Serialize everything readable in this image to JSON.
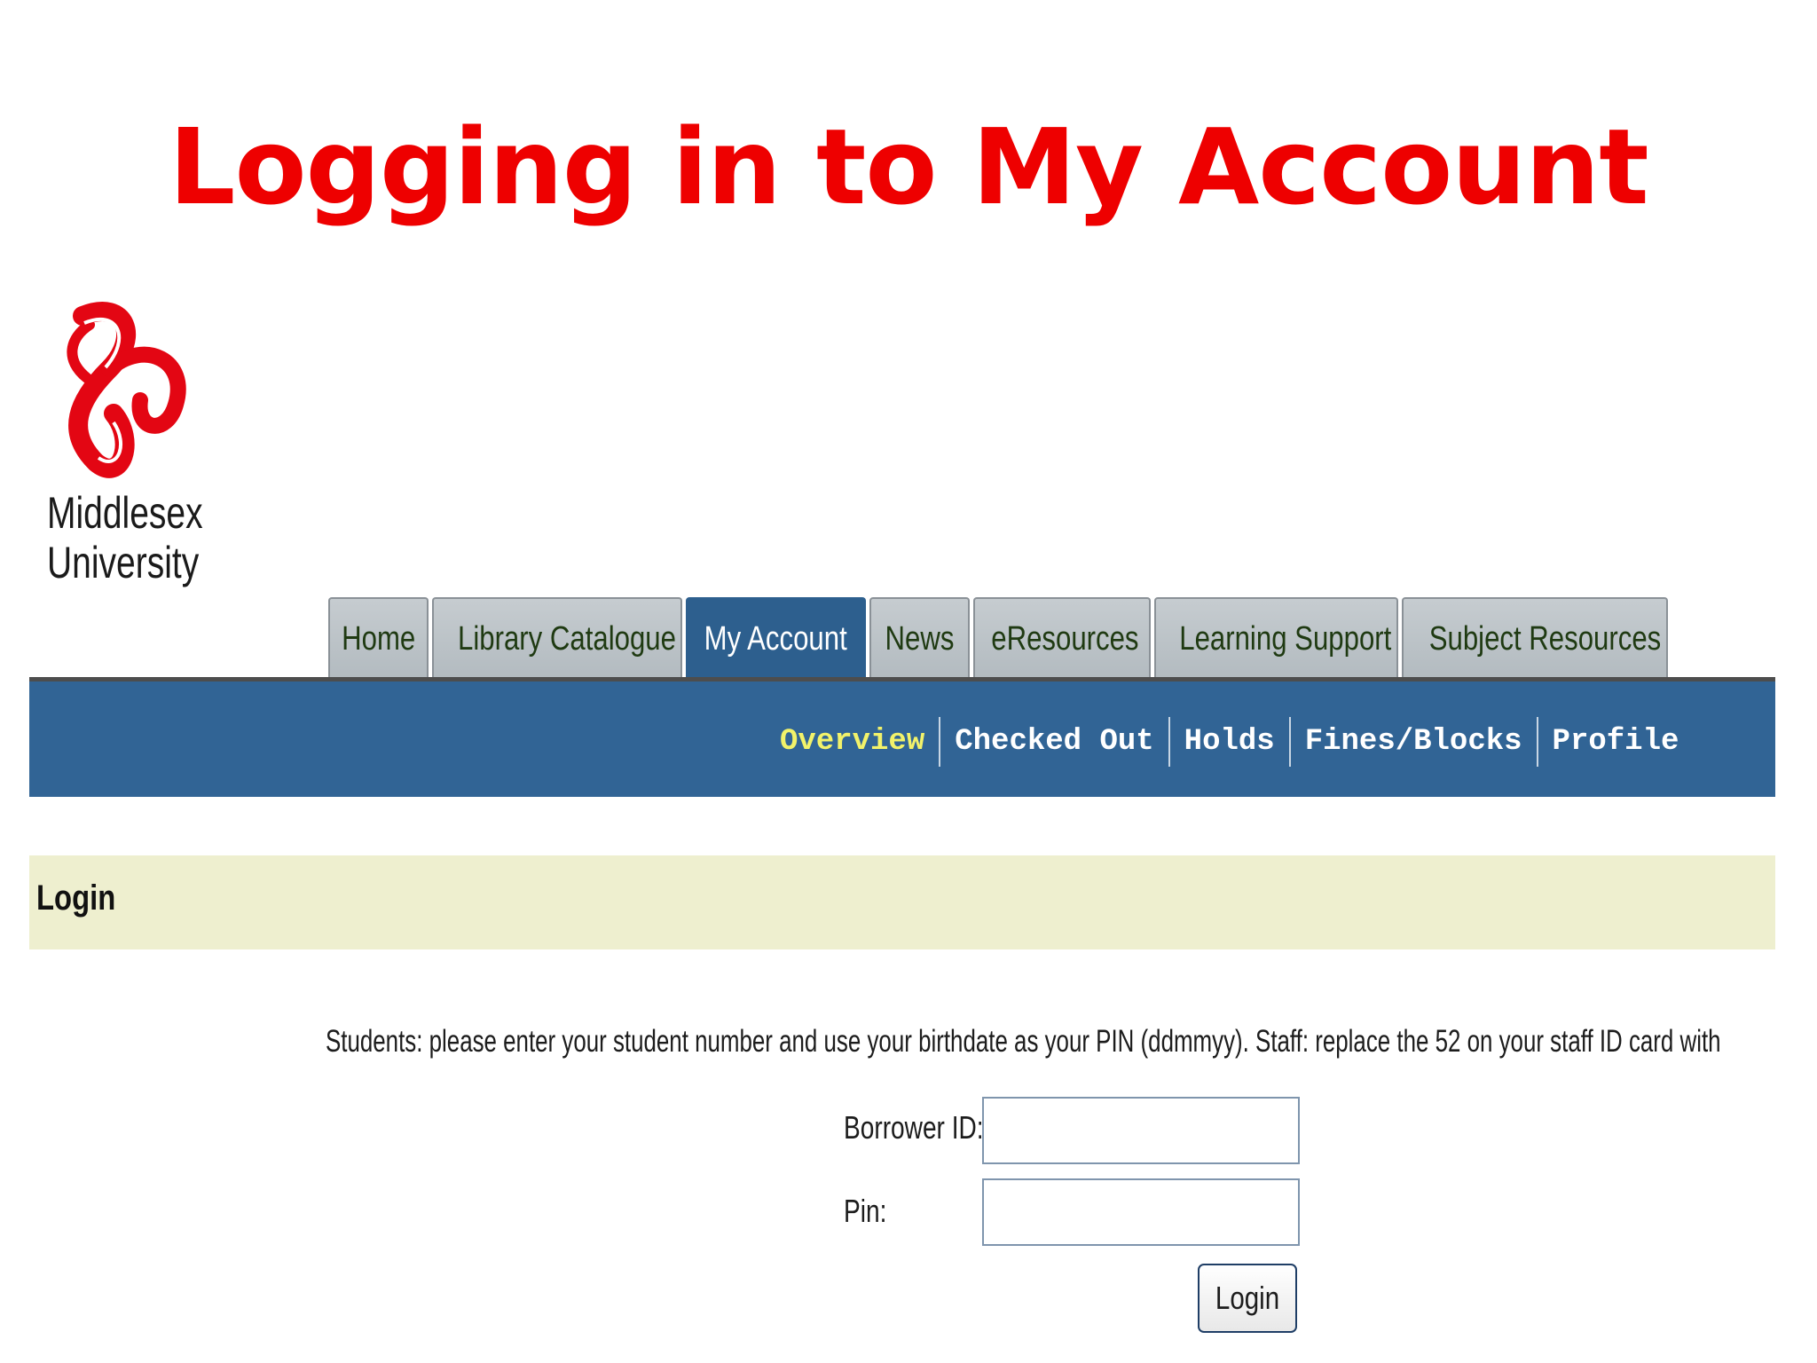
{
  "slide": {
    "title": "Logging in to My Account"
  },
  "logo": {
    "line1": "Middlesex",
    "line2": "University",
    "color": "#e30613"
  },
  "main_tabs": [
    {
      "label": "Home",
      "active": false
    },
    {
      "label": "Library Catalogue",
      "active": false
    },
    {
      "label": "My Account",
      "active": true
    },
    {
      "label": "News",
      "active": false
    },
    {
      "label": "eResources",
      "active": false
    },
    {
      "label": "Learning Support",
      "active": false
    },
    {
      "label": "Subject Resources",
      "active": false
    }
  ],
  "sub_tabs": [
    {
      "label": "Overview",
      "current": true
    },
    {
      "label": "Checked Out",
      "current": false
    },
    {
      "label": "Holds",
      "current": false
    },
    {
      "label": "Fines/Blocks",
      "current": false
    },
    {
      "label": "Profile",
      "current": false
    }
  ],
  "login_section": {
    "title": "Login",
    "instructions": "Students: please enter your student number and use your birthdate as your PIN (ddmmyy). Staff: replace the 52 on your staff ID card with",
    "borrower_id_label": "Borrower ID:",
    "borrower_id_value": "",
    "pin_label": "Pin:",
    "pin_value": "",
    "submit_label": "Login"
  },
  "colors": {
    "title_red": "#ee0000",
    "nav_blue": "#316495",
    "current_subtab": "#f2f26a",
    "login_bar": "#eeefcf"
  }
}
